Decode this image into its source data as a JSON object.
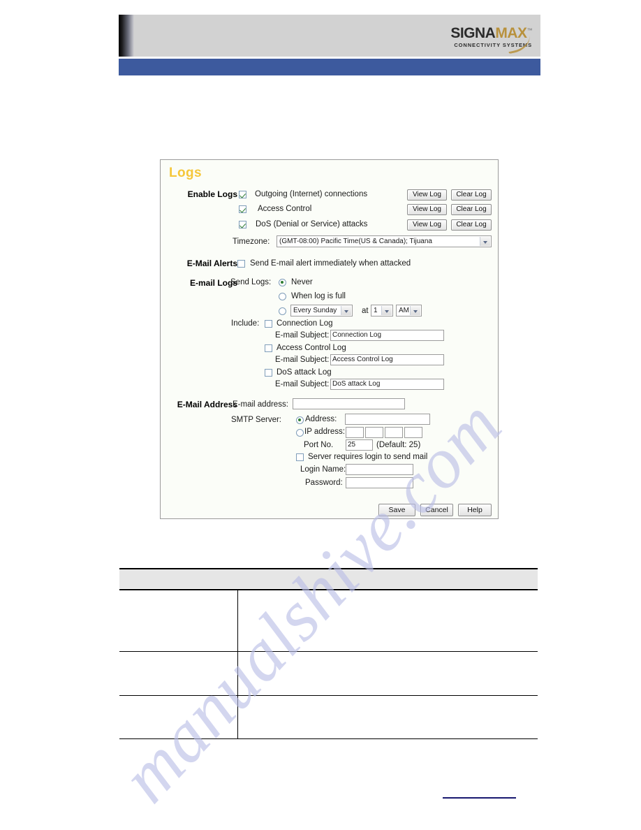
{
  "document": {
    "watermark_text": "manualshive.com",
    "brand": {
      "name_part1": "SIGNA",
      "name_part2": "MAX",
      "trademark": "™",
      "tagline": "CONNECTIVITY SYSTEMS"
    }
  },
  "panel": {
    "title": "Logs",
    "sections": {
      "enable_logs": {
        "label": "Enable Logs",
        "rows": [
          {
            "label": "Outgoing (Internet) connections",
            "checked": true,
            "view_button": "View Log",
            "clear_button": "Clear Log"
          },
          {
            "label": "Access Control",
            "checked": true,
            "view_button": "View Log",
            "clear_button": "Clear Log"
          },
          {
            "label": "DoS (Denial or Service) attacks",
            "checked": true,
            "view_button": "View Log",
            "clear_button": "Clear Log"
          }
        ],
        "timezone_label": "Timezone:",
        "timezone_value": "(GMT-08:00) Pacific Time(US & Canada); Tijuana"
      },
      "email_alerts": {
        "label": "E-Mail Alerts",
        "checkbox_label": "Send E-mail alert immediately when attacked",
        "checked": false
      },
      "email_logs": {
        "label": "E-mail Logs",
        "send_logs_label": "Send Logs:",
        "option_never": "Never",
        "option_when_full": "When log is full",
        "schedule_day": "Every Sunday",
        "schedule_at": "at",
        "schedule_hour": "1",
        "schedule_meridiem": "AM",
        "include_label": "Include:",
        "items": [
          {
            "checkbox_label": "Connection Log",
            "checked": false,
            "subject_label": "E-mail Subject:",
            "subject_value": "Connection Log"
          },
          {
            "checkbox_label": "Access Control Log",
            "checked": false,
            "subject_label": "E-mail Subject:",
            "subject_value": "Access Control Log"
          },
          {
            "checkbox_label": "DoS attack Log",
            "checked": false,
            "subject_label": "E-mail Subject:",
            "subject_value": "DoS attack Log"
          }
        ]
      },
      "email_address": {
        "label": "E-Mail Address",
        "email_address_label": "E-mail address:",
        "email_address_value": "",
        "smtp_server_label": "SMTP Server:",
        "radio_address_label": "Address:",
        "address_value": "",
        "radio_ip_label": "IP address:",
        "ip_octets": [
          "",
          "",
          "",
          ""
        ],
        "port_label": "Port No.",
        "port_value": "25",
        "port_default_note": "(Default: 25)",
        "login_required_label": "Server requires login to send mail",
        "login_required_checked": false,
        "login_name_label": "Login Name:",
        "login_name_value": "",
        "password_label": "Password:",
        "password_value": ""
      }
    },
    "buttons": {
      "save": "Save",
      "cancel": "Cancel",
      "help": "Help"
    }
  },
  "description_table": {
    "header": "",
    "rows": [
      {
        "name": "",
        "description": ""
      },
      {
        "name": "",
        "description": ""
      },
      {
        "name": "",
        "description": ""
      }
    ]
  },
  "footer": {
    "link_text": ""
  }
}
